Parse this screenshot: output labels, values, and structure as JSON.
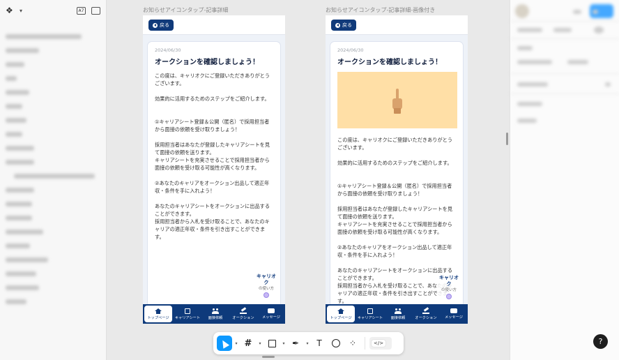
{
  "frames": [
    {
      "label": "お知らせアイコンタップ-記事詳細",
      "back_label": "戻る",
      "date": "2024/06/30",
      "title": "オークションを確認しましょう！",
      "has_image": false,
      "paragraphs": [
        "この度は、キャリオクにご登録いただきありがとうございます。",
        "効果的に活用するためのステップをご紹介します。",
        "",
        "①キャリアシート登録＆公開（匿名）で採用担当者から面接の依頼を受け取りましょう！",
        "採用担当者はあなたが登録したキャリアシートを見て面接の依頼を送ります。\nキャリアシートを充実させることで採用担当者から面接の依頼を受け取る可能性が高くなります。",
        "②あなたのキャリアをオークション出品して適正年収・条件を手に入れよう！",
        "あなたのキャリアシートをオークションに出品することができます。\n採用担当者から入札を受け取ることで、あなたのキャリアの適正年収・条件を引き出すことができます。"
      ]
    },
    {
      "label": "お知らせアイコンタップ-記事詳細-画像付き",
      "back_label": "戻る",
      "date": "2024/06/30",
      "title": "オークションを確認しましょう！",
      "has_image": true,
      "paragraphs": [
        "この度は、キャリオクにご登録いただきありがとうございます。",
        "効果的に活用するためのステップをご紹介します。",
        "",
        "①キャリアシート登録＆公開（匿名）で採用担当者から面接の依頼を受け取りましょう！",
        "採用担当者はあなたが登録したキャリアシートを見て面接の依頼を送ります。\nキャリアシートを充実させることで採用担当者から面接の依頼を受け取る可能性が高くなります。",
        "②あなたのキャリアをオークション出品して適正年収・条件を手に入れよう！",
        "あなたのキャリアシートをオークションに出品することができます。\n採用担当者から入札を受け取ることで、あなたのキャリアの適正年収・条件を引き出すことができます。"
      ]
    }
  ],
  "help_badge": {
    "logo": "キャリオク",
    "text": "の使い方"
  },
  "tabs": [
    "トップページ",
    "キャリアシート",
    "面接依頼",
    "オークション",
    "メッセージ"
  ],
  "tab_icons": [
    "home-icon",
    "document-icon",
    "people-icon",
    "gavel-icon",
    "chat-icon"
  ],
  "toolbar": {
    "tools": [
      "move-tool",
      "frame-tool",
      "shape-tool",
      "pen-tool",
      "text-tool",
      "comment-tool",
      "actions-tool",
      "dev-mode-toggle"
    ],
    "text_glyph": "T",
    "frame_glyph": "#",
    "code_glyph": "</>"
  },
  "left_panel": {
    "toggle_label": "A7"
  },
  "help_fab": "?",
  "colors": {
    "brand_navy": "#0e3a7b",
    "hero_bg": "#ffdfa6",
    "accent_blue": "#0d99ff"
  }
}
